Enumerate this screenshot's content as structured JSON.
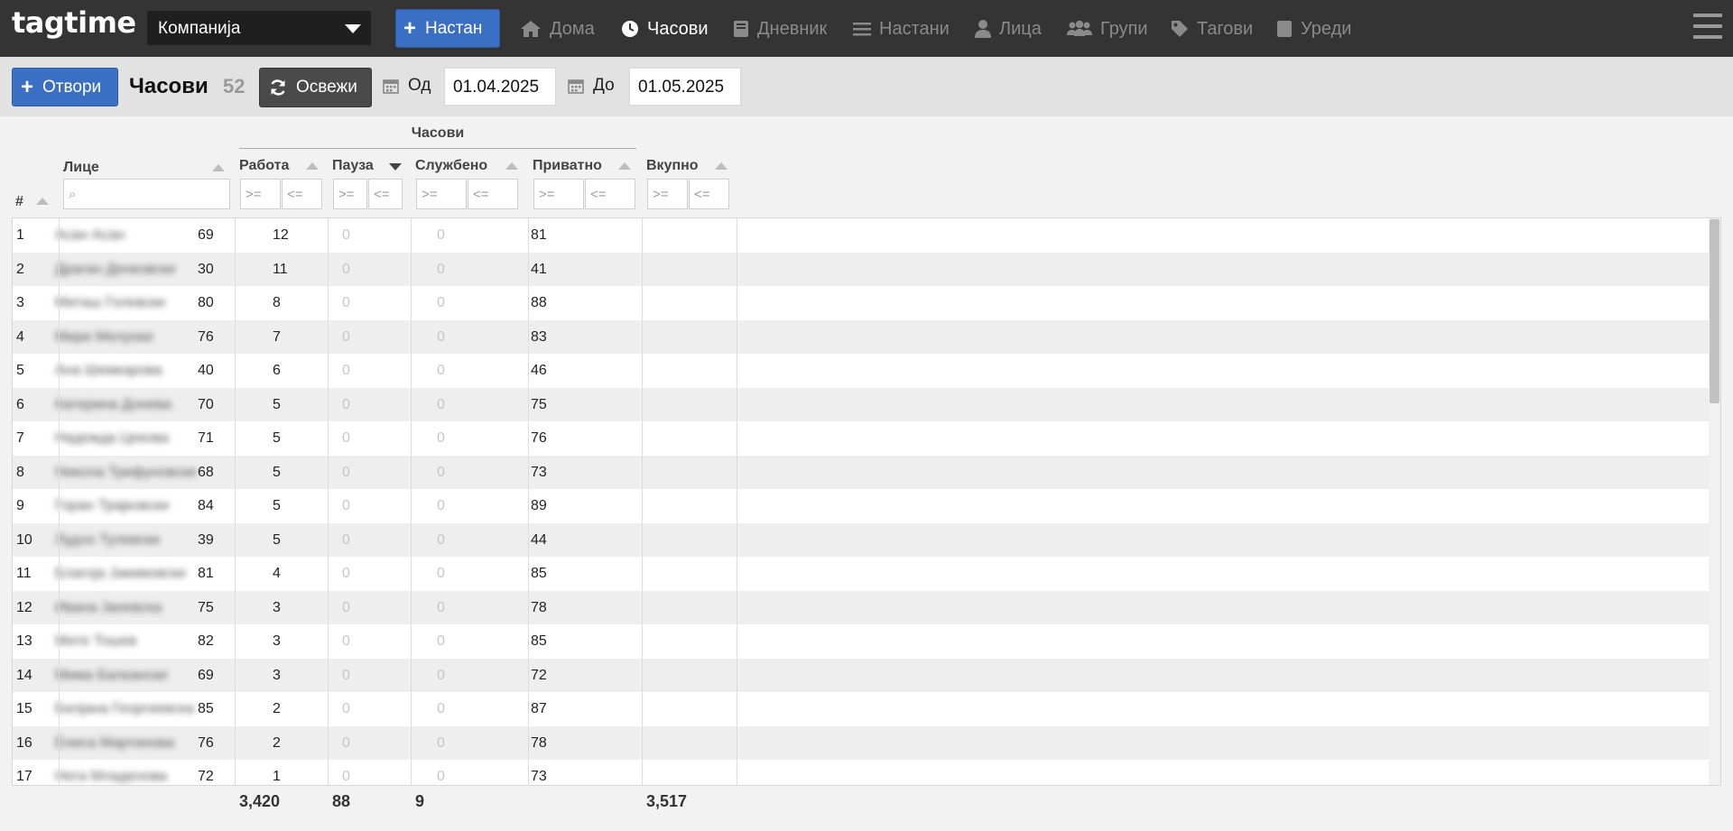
{
  "app": {
    "logo": "tagtime",
    "company": "Компанија",
    "new_button": "Настан"
  },
  "nav": [
    {
      "label": "Дома",
      "icon": "home-icon",
      "active": false
    },
    {
      "label": "Часови",
      "icon": "clock-icon",
      "active": true
    },
    {
      "label": "Дневник",
      "icon": "book-icon",
      "active": false
    },
    {
      "label": "Настани",
      "icon": "list-icon",
      "active": false
    },
    {
      "label": "Лица",
      "icon": "user-icon",
      "active": false
    },
    {
      "label": "Групи",
      "icon": "users-icon",
      "active": false
    },
    {
      "label": "Тагови",
      "icon": "tag-icon",
      "active": false
    },
    {
      "label": "Уреди",
      "icon": "device-icon",
      "active": false
    }
  ],
  "toolbar": {
    "open_button": "Отвори",
    "title": "Часови",
    "count": "52",
    "refresh_button": "Освежи",
    "from_label": "Од",
    "from_value": "01.04.2025",
    "to_label": "До",
    "to_value": "01.05.2025"
  },
  "table": {
    "group_header": "Часови",
    "columns": {
      "index": "#",
      "person": "Лице",
      "work": "Работа",
      "pause": "Пауза",
      "business": "Службено",
      "private": "Приватно",
      "total": "Вкупно"
    },
    "filters": {
      "search_placeholder": "⌕",
      "gte": ">=",
      "lte": "<="
    },
    "rows": [
      {
        "n": "1",
        "name": "Асан Асан",
        "work": "69",
        "pause": "12",
        "business": "0",
        "private": "0",
        "total": "81"
      },
      {
        "n": "2",
        "name": "Драган Денковски",
        "work": "30",
        "pause": "11",
        "business": "0",
        "private": "0",
        "total": "41"
      },
      {
        "n": "3",
        "name": "Миташ Голевски",
        "work": "80",
        "pause": "8",
        "business": "0",
        "private": "0",
        "total": "88"
      },
      {
        "n": "4",
        "name": "Мири Мелуоки",
        "work": "76",
        "pause": "7",
        "business": "0",
        "private": "0",
        "total": "83"
      },
      {
        "n": "5",
        "name": "Ана Шемкарова",
        "work": "40",
        "pause": "6",
        "business": "0",
        "private": "0",
        "total": "46"
      },
      {
        "n": "6",
        "name": "Катерина Донева",
        "work": "70",
        "pause": "5",
        "business": "0",
        "private": "0",
        "total": "75"
      },
      {
        "n": "7",
        "name": "Надежда Цекова",
        "work": "71",
        "pause": "5",
        "business": "0",
        "private": "0",
        "total": "76"
      },
      {
        "n": "8",
        "name": "Никола Трифуновски",
        "work": "68",
        "pause": "5",
        "business": "0",
        "private": "0",
        "total": "73"
      },
      {
        "n": "9",
        "name": "Горан Трајковски",
        "work": "84",
        "pause": "5",
        "business": "0",
        "private": "0",
        "total": "89"
      },
      {
        "n": "10",
        "name": "Лудчо Тулевски",
        "work": "39",
        "pause": "5",
        "business": "0",
        "private": "0",
        "total": "44"
      },
      {
        "n": "11",
        "name": "Благоја Јакимовски",
        "work": "81",
        "pause": "4",
        "business": "0",
        "private": "0",
        "total": "85"
      },
      {
        "n": "12",
        "name": "Ивана Јаневска",
        "work": "75",
        "pause": "3",
        "business": "0",
        "private": "0",
        "total": "78"
      },
      {
        "n": "13",
        "name": "Мите Тошев",
        "work": "82",
        "pause": "3",
        "business": "0",
        "private": "0",
        "total": "85"
      },
      {
        "n": "14",
        "name": "Мима Балкански",
        "work": "69",
        "pause": "3",
        "business": "0",
        "private": "0",
        "total": "72"
      },
      {
        "n": "15",
        "name": "Билјана Георгиевска",
        "work": "85",
        "pause": "2",
        "business": "0",
        "private": "0",
        "total": "87"
      },
      {
        "n": "16",
        "name": "Ениса Мартинова",
        "work": "76",
        "pause": "2",
        "business": "0",
        "private": "0",
        "total": "78"
      },
      {
        "n": "17",
        "name": "Нега Младенова",
        "work": "72",
        "pause": "1",
        "business": "0",
        "private": "0",
        "total": "73"
      }
    ],
    "totals": {
      "work": "3,420",
      "pause": "88",
      "business": "9",
      "total": "3,517"
    }
  },
  "colors": {
    "topbar": "#343434",
    "accent": "#3a6fc4",
    "toolbar": "#e2e2e2",
    "row_alt": "#eeeeee"
  }
}
